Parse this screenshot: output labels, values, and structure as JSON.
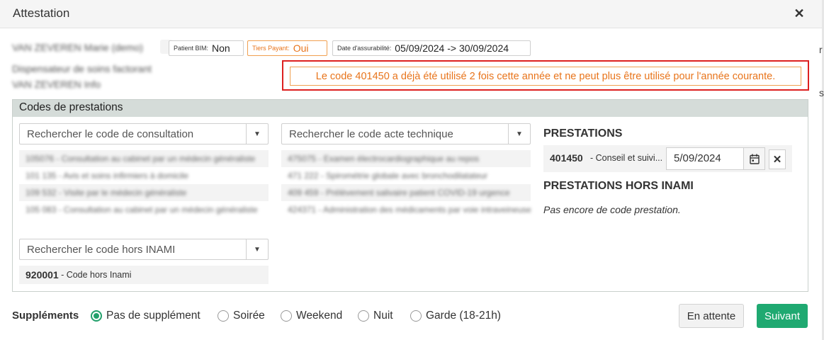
{
  "dialog": {
    "title": "Attestation"
  },
  "patient": {
    "name": "VAN ZEVEREN Marie (demo)",
    "line2": "Dispensateur de soins factorant",
    "line3": "VAN ZEVEREN Info"
  },
  "badges": {
    "bim": {
      "label": "Patient BIM:",
      "value": "Non"
    },
    "tiers": {
      "label": "Tiers Payant:",
      "value": "Oui"
    },
    "assur": {
      "label": "Date d'assurabilité:",
      "value": "05/09/2024 -> 30/09/2024"
    }
  },
  "alert": {
    "text": "Le code 401450 a déjà été utilisé 2 fois cette année et ne peut plus être utilisé pour l'année courante."
  },
  "section": {
    "title": "Codes de prestations"
  },
  "consultation": {
    "placeholder": "Rechercher le code de consultation",
    "items": [
      "105076 - Consultation au cabinet par un médecin généraliste",
      "101 135 - Avis et soins infirmiers à domicile",
      "109 532 - Visite par le médecin généraliste",
      "105 083 - Consultation au cabinet par un médecin généraliste"
    ]
  },
  "acte": {
    "placeholder": "Rechercher le code acte technique",
    "items": [
      "475075 - Examen électrocardiographique au repos",
      "471 222 - Spirométrie globale avec bronchodilatateur",
      "409 459 - Prélèvement salivaire patient COVID-19 urgence",
      "424371 - Administration des médicaments par voie intraveineuse"
    ]
  },
  "hors": {
    "placeholder": "Rechercher le code hors INAMI",
    "items": [
      {
        "code": "920001",
        "desc": "- Code hors Inami"
      }
    ]
  },
  "prestations": {
    "heading": "PRESTATIONS",
    "item": {
      "code": "401450",
      "desc": "- Conseil et suivi...",
      "date": "5/09/2024"
    },
    "hors_heading": "PRESTATIONS HORS INAMI",
    "empty_text": "Pas encore de code prestation."
  },
  "supplements": {
    "label": "Suppléments",
    "options": [
      "Pas de supplément",
      "Soirée",
      "Weekend",
      "Nuit",
      "Garde (18-21h)"
    ],
    "selected": "Pas de supplément"
  },
  "actions": {
    "wait_label": "En attente",
    "next_label": "Suivant"
  },
  "colors": {
    "primary": "#1fa971",
    "warning": "#e8741b",
    "alert_border": "#dd2020"
  },
  "stub": {
    "a": "r",
    "b": "s"
  }
}
